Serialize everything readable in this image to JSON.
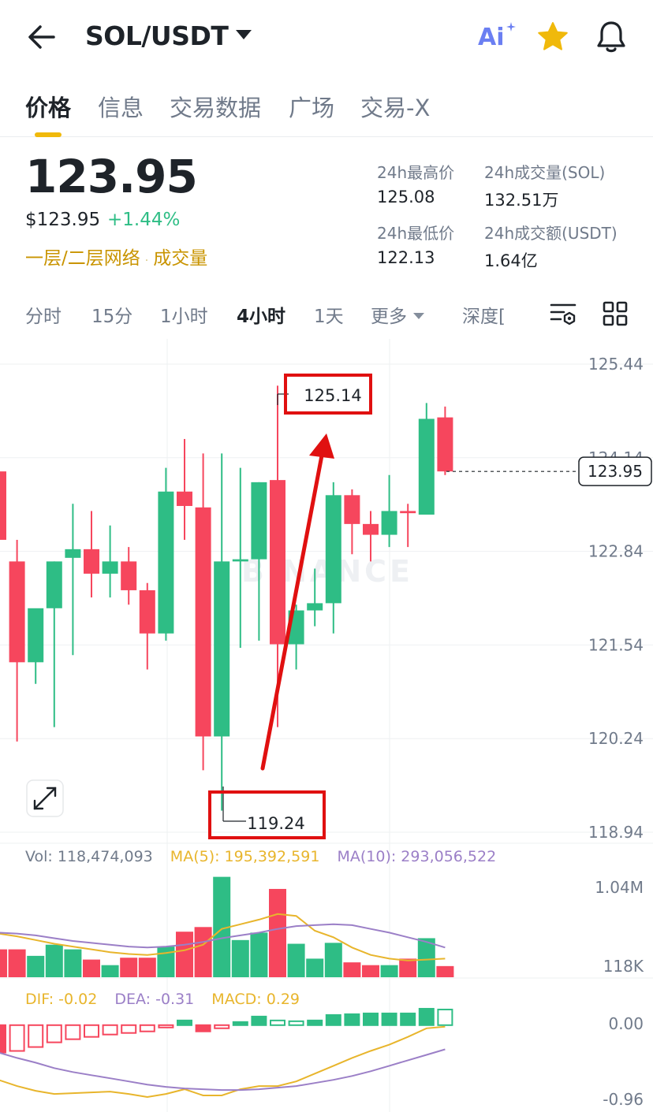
{
  "header": {
    "pair": "SOL/USDT",
    "icons": {
      "back": "arrow-left-icon",
      "ai": "ai-icon",
      "favorite": "star-icon",
      "notifications": "bell-icon"
    },
    "ai_label": "Ai"
  },
  "tabs": [
    {
      "label": "价格",
      "active": true
    },
    {
      "label": "信息",
      "active": false
    },
    {
      "label": "交易数据",
      "active": false
    },
    {
      "label": "广场",
      "active": false
    },
    {
      "label": "交易-X",
      "active": false
    }
  ],
  "ticker": {
    "price": "123.95",
    "usd_price": "$123.95",
    "change": "+1.44%",
    "tags": [
      "一层/二层网络",
      "成交量"
    ],
    "stats": {
      "high_label": "24h最高价",
      "high_value": "125.08",
      "vol_sol_label": "24h成交量(SOL)",
      "vol_sol_value": "132.51万",
      "low_label": "24h最低价",
      "low_value": "122.13",
      "vol_usdt_label": "24h成交额(USDT)",
      "vol_usdt_value": "1.64亿"
    }
  },
  "intervals": {
    "items": [
      "分时",
      "15分",
      "1小时",
      "4小时",
      "1天",
      "更多",
      "深度["
    ],
    "active": "4小时",
    "icons": [
      "indicator-settings-icon",
      "grid-layout-icon"
    ]
  },
  "colors": {
    "up": "#2ebd85",
    "down": "#f6465d",
    "accent": "#f0b90b",
    "ma5": "#e8b52c",
    "ma10": "#9b7fc7",
    "annotation": "#e01010"
  },
  "chart_data": [
    {
      "type": "candlestick",
      "watermark": "BINANCE",
      "y_ticks": [
        "125.44",
        "124.14",
        "122.84",
        "121.54",
        "120.24",
        "118.94"
      ],
      "ylim": [
        118.94,
        125.44
      ],
      "current_price_label": "123.95",
      "current_price": 123.95,
      "annotations": {
        "high": "125.14",
        "low": "119.24"
      },
      "candles": [
        {
          "o": 123.95,
          "h": 124.0,
          "l": 123.0,
          "c": 123.0
        },
        {
          "o": 122.7,
          "h": 123.0,
          "l": 120.2,
          "c": 121.3
        },
        {
          "o": 121.3,
          "h": 122.0,
          "l": 121.0,
          "c": 122.05
        },
        {
          "o": 122.05,
          "h": 122.7,
          "l": 120.4,
          "c": 122.7
        },
        {
          "o": 122.75,
          "h": 123.5,
          "l": 121.4,
          "c": 122.87
        },
        {
          "o": 122.87,
          "h": 123.4,
          "l": 122.2,
          "c": 122.53
        },
        {
          "o": 122.53,
          "h": 123.2,
          "l": 122.2,
          "c": 122.7
        },
        {
          "o": 122.7,
          "h": 122.9,
          "l": 122.1,
          "c": 122.3
        },
        {
          "o": 122.3,
          "h": 122.4,
          "l": 121.2,
          "c": 121.7
        },
        {
          "o": 121.7,
          "h": 124.0,
          "l": 121.6,
          "c": 123.67
        },
        {
          "o": 123.67,
          "h": 124.4,
          "l": 123.0,
          "c": 123.47
        },
        {
          "o": 123.45,
          "h": 124.2,
          "l": 119.8,
          "c": 120.27
        },
        {
          "o": 120.27,
          "h": 124.2,
          "l": 119.24,
          "c": 122.7
        },
        {
          "o": 122.7,
          "h": 124.0,
          "l": 121.5,
          "c": 122.73
        },
        {
          "o": 122.73,
          "h": 123.8,
          "l": 121.6,
          "c": 123.8
        },
        {
          "o": 123.83,
          "h": 125.14,
          "l": 120.4,
          "c": 121.55
        },
        {
          "o": 121.55,
          "h": 122.1,
          "l": 121.2,
          "c": 122.02
        },
        {
          "o": 122.02,
          "h": 122.6,
          "l": 121.8,
          "c": 122.12
        },
        {
          "o": 122.12,
          "h": 123.8,
          "l": 121.7,
          "c": 123.62
        },
        {
          "o": 123.62,
          "h": 123.7,
          "l": 122.8,
          "c": 123.22
        },
        {
          "o": 123.22,
          "h": 123.4,
          "l": 122.7,
          "c": 123.07
        },
        {
          "o": 123.07,
          "h": 123.9,
          "l": 122.9,
          "c": 123.4
        },
        {
          "o": 123.4,
          "h": 123.5,
          "l": 122.9,
          "c": 123.37
        },
        {
          "o": 123.35,
          "h": 124.9,
          "l": 123.35,
          "c": 124.68
        },
        {
          "o": 124.7,
          "h": 124.85,
          "l": 123.9,
          "c": 123.95
        }
      ]
    },
    {
      "type": "bar",
      "legend": {
        "vol": "Vol: 118,474,093",
        "ma5": "MA(5): 195,392,591",
        "ma10": "MA(10): 293,056,522"
      },
      "y_ticks": [
        "1.04M",
        "118K"
      ],
      "ylim_k": [
        0,
        1170
      ],
      "volumes_k": [
        300,
        300,
        230,
        350,
        300,
        190,
        130,
        210,
        210,
        330,
        490,
        540,
        1080,
        400,
        480,
        950,
        360,
        200,
        370,
        160,
        130,
        130,
        200,
        420,
        120
      ],
      "ma5_k": [
        470,
        440,
        400,
        360,
        330,
        300,
        270,
        250,
        240,
        260,
        290,
        350,
        520,
        570,
        620,
        680,
        660,
        500,
        430,
        320,
        240,
        200,
        180,
        190,
        200
      ],
      "ma10_k": [
        480,
        470,
        450,
        420,
        390,
        370,
        350,
        330,
        320,
        330,
        350,
        380,
        420,
        450,
        480,
        520,
        550,
        560,
        570,
        560,
        520,
        480,
        430,
        380,
        320
      ]
    },
    {
      "type": "bar",
      "legend": {
        "dif": "DIF: -0.02",
        "dea": "DEA: -0.31",
        "macd": "MACD: 0.29"
      },
      "y_ticks": [
        "0.00",
        "-0.96"
      ],
      "ylim": [
        -0.96,
        0.25
      ],
      "macd": [
        -0.35,
        -0.33,
        -0.28,
        -0.22,
        -0.18,
        -0.15,
        -0.12,
        -0.1,
        -0.08,
        -0.03,
        0.06,
        -0.08,
        -0.04,
        0.04,
        0.11,
        0.06,
        0.05,
        0.06,
        0.13,
        0.14,
        0.15,
        0.15,
        0.15,
        0.21,
        0.2
      ],
      "dif": [
        -0.7,
        -0.78,
        -0.84,
        -0.88,
        -0.87,
        -0.86,
        -0.85,
        -0.88,
        -0.92,
        -0.88,
        -0.82,
        -0.9,
        -0.9,
        -0.82,
        -0.78,
        -0.78,
        -0.72,
        -0.62,
        -0.52,
        -0.42,
        -0.33,
        -0.25,
        -0.15,
        -0.04,
        -0.02
      ],
      "dea": [
        -0.35,
        -0.42,
        -0.48,
        -0.55,
        -0.6,
        -0.64,
        -0.68,
        -0.72,
        -0.76,
        -0.79,
        -0.81,
        -0.82,
        -0.83,
        -0.83,
        -0.82,
        -0.8,
        -0.78,
        -0.74,
        -0.7,
        -0.65,
        -0.59,
        -0.52,
        -0.45,
        -0.38,
        -0.31
      ]
    }
  ]
}
